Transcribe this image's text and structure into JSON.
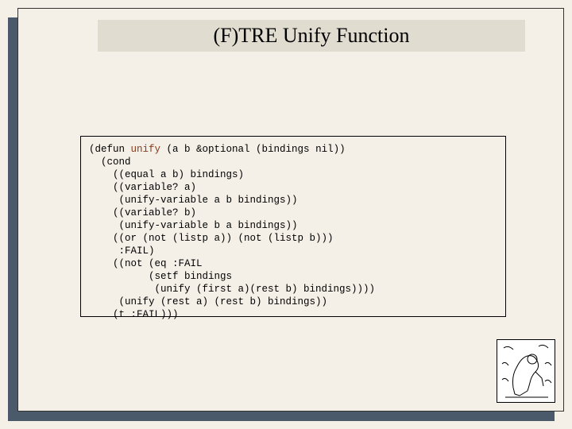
{
  "title": "(F)TRE Unify Function",
  "code": {
    "l1a": "(defun ",
    "l1fn": "unify",
    "l1b": " (a b &optional (bindings nil))",
    "l2": "  (cond",
    "l3": "    ((equal a b) bindings)",
    "l4": "    ((variable? a)",
    "l5": "     (unify-variable a b bindings))",
    "l6": "    ((variable? b)",
    "l7": "     (unify-variable b a bindings))",
    "l8": "    ((or (not (listp a)) (not (listp b)))",
    "l9": "     :FAIL)",
    "l10": "    ((not (eq :FAIL",
    "l11": "          (setf bindings",
    "l12": "           (unify (first a)(rest b) bindings))))",
    "l13": "     (unify (rest a) (rest b) bindings))",
    "l14": "    (t :FAIL)))"
  }
}
